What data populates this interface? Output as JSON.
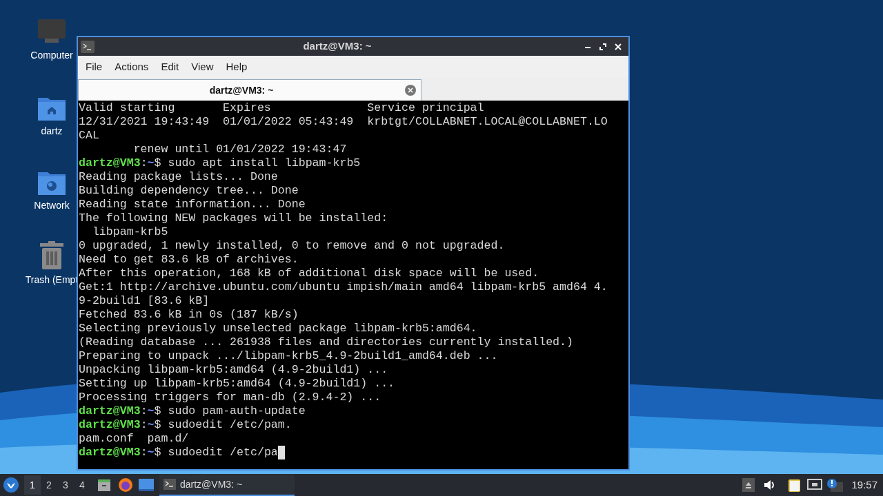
{
  "desktop_icons": [
    {
      "kind": "computer",
      "label": "Computer"
    },
    {
      "kind": "home",
      "label": "dartz"
    },
    {
      "kind": "network",
      "label": "Network"
    },
    {
      "kind": "trash",
      "label": "Trash (Empt"
    }
  ],
  "window": {
    "title": "dartz@VM3: ~",
    "menu": [
      "File",
      "Actions",
      "Edit",
      "View",
      "Help"
    ],
    "tabs": [
      {
        "label": "dartz@VM3: ~",
        "selected": true
      }
    ]
  },
  "terminal": {
    "lines": [
      {
        "kind": "output",
        "text": "Valid starting       Expires              Service principal"
      },
      {
        "kind": "output",
        "text": "12/31/2021 19:43:49  01/01/2022 05:43:49  krbtgt/COLLABNET.LOCAL@COLLABNET.LO"
      },
      {
        "kind": "output",
        "text": "CAL"
      },
      {
        "kind": "output",
        "text": "        renew until 01/01/2022 19:43:47"
      },
      {
        "kind": "prompt",
        "user": "dartz@VM3",
        "sep": ":",
        "path": "~",
        "command": "$ sudo apt install libpam-krb5"
      },
      {
        "kind": "output",
        "text": "Reading package lists... Done"
      },
      {
        "kind": "output",
        "text": "Building dependency tree... Done"
      },
      {
        "kind": "output",
        "text": "Reading state information... Done"
      },
      {
        "kind": "output",
        "text": "The following NEW packages will be installed:"
      },
      {
        "kind": "output",
        "text": "  libpam-krb5"
      },
      {
        "kind": "output",
        "text": "0 upgraded, 1 newly installed, 0 to remove and 0 not upgraded."
      },
      {
        "kind": "output",
        "text": "Need to get 83.6 kB of archives."
      },
      {
        "kind": "output",
        "text": "After this operation, 168 kB of additional disk space will be used."
      },
      {
        "kind": "output",
        "text": "Get:1 http://archive.ubuntu.com/ubuntu impish/main amd64 libpam-krb5 amd64 4."
      },
      {
        "kind": "output",
        "text": "9-2build1 [83.6 kB]"
      },
      {
        "kind": "output",
        "text": "Fetched 83.6 kB in 0s (187 kB/s)"
      },
      {
        "kind": "output",
        "text": "Selecting previously unselected package libpam-krb5:amd64."
      },
      {
        "kind": "output",
        "text": "(Reading database ... 261938 files and directories currently installed.)"
      },
      {
        "kind": "output",
        "text": "Preparing to unpack .../libpam-krb5_4.9-2build1_amd64.deb ..."
      },
      {
        "kind": "output",
        "text": "Unpacking libpam-krb5:amd64 (4.9-2build1) ..."
      },
      {
        "kind": "output",
        "text": "Setting up libpam-krb5:amd64 (4.9-2build1) ..."
      },
      {
        "kind": "output",
        "text": "Processing triggers for man-db (2.9.4-2) ..."
      },
      {
        "kind": "prompt",
        "user": "dartz@VM3",
        "sep": ":",
        "path": "~",
        "command": "$ sudo pam-auth-update"
      },
      {
        "kind": "prompt",
        "user": "dartz@VM3",
        "sep": ":",
        "path": "~",
        "command": "$ sudoedit /etc/pam."
      },
      {
        "kind": "output",
        "text": "pam.conf  pam.d/"
      },
      {
        "kind": "prompt",
        "user": "dartz@VM3",
        "sep": ":",
        "path": "~",
        "command": "$ sudoedit /etc/pa",
        "cursor": true
      }
    ]
  },
  "taskbar": {
    "workspaces": [
      {
        "label": "1",
        "selected": true
      },
      {
        "label": "2",
        "selected": false
      },
      {
        "label": "3",
        "selected": false
      },
      {
        "label": "4",
        "selected": false
      }
    ],
    "tasks": [
      {
        "label": "dartz@VM3: ~",
        "selected": true
      }
    ],
    "clock": "19:57"
  }
}
